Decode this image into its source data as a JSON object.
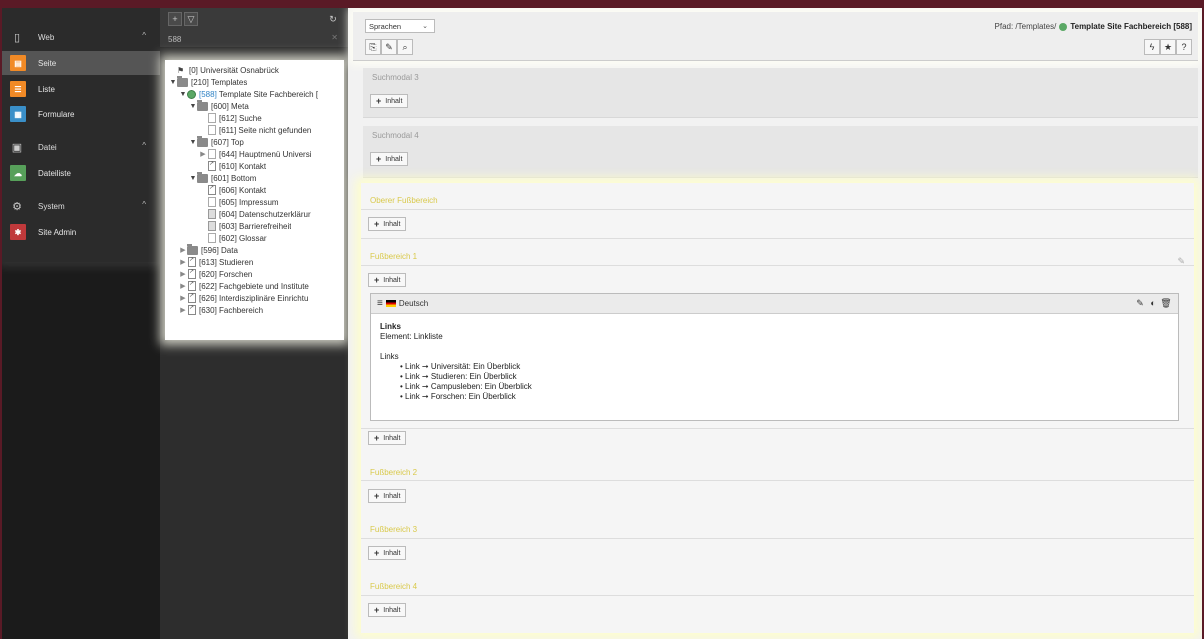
{
  "modmenu": {
    "groups": [
      {
        "label": "Web",
        "icon": "page-icon"
      },
      {
        "label": "Datei",
        "icon": "image-icon"
      },
      {
        "label": "System",
        "icon": "gear-icon"
      }
    ],
    "items": [
      {
        "label": "Seite",
        "color": "#f18a26"
      },
      {
        "label": "Liste",
        "color": "#f18a26"
      },
      {
        "label": "Formulare",
        "color": "#3a8fc8"
      },
      {
        "label": "Dateiliste",
        "color": "#57a05a"
      },
      {
        "label": "Site Admin",
        "color": "#c0393b"
      }
    ]
  },
  "tree": {
    "filter_value": "588",
    "nodes": [
      {
        "uid": "[0]",
        "label": " Universität Osnabrück"
      },
      {
        "uid": "[210]",
        "label": " Templates"
      },
      {
        "uid": "[588]",
        "label": " Template Site Fachbereich ["
      },
      {
        "uid": "[600]",
        "label": " Meta"
      },
      {
        "uid": "[612]",
        "label": " Suche"
      },
      {
        "uid": "[611]",
        "label": " Seite nicht gefunden"
      },
      {
        "uid": "[607]",
        "label": " Top"
      },
      {
        "uid": "[644]",
        "label": " Hauptmenü Universi"
      },
      {
        "uid": "[610]",
        "label": " Kontakt"
      },
      {
        "uid": "[601]",
        "label": " Bottom"
      },
      {
        "uid": "[606]",
        "label": " Kontakt"
      },
      {
        "uid": "[605]",
        "label": " Impressum"
      },
      {
        "uid": "[604]",
        "label": " Datenschutzerklärur"
      },
      {
        "uid": "[603]",
        "label": " Barrierefreiheit"
      },
      {
        "uid": "[602]",
        "label": " Glossar"
      },
      {
        "uid": "[596]",
        "label": " Data"
      },
      {
        "uid": "[613]",
        "label": " Studieren"
      },
      {
        "uid": "[620]",
        "label": " Forschen"
      },
      {
        "uid": "[622]",
        "label": " Fachgebiete und Institute"
      },
      {
        "uid": "[626]",
        "label": " Interdisziplinäre Einrichtu"
      },
      {
        "uid": "[630]",
        "label": " Fachbereich"
      }
    ]
  },
  "header": {
    "language_select": "Sprachen",
    "path_prefix": "Pfad: /Templates/",
    "path_title": "Template Site Fachbereich [588]"
  },
  "content": {
    "add_label": "Inhalt",
    "dim_columns": [
      "Suchmodal 3",
      "Suchmodal 4"
    ],
    "zones": [
      "Oberer Fußbereich",
      "Fußbereich 1",
      "Fußbereich 2",
      "Fußbereich 3",
      "Fußbereich 4"
    ],
    "element": {
      "language": "Deutsch",
      "title": "Links",
      "type_line": "Element: Linkliste",
      "links_heading": "Links",
      "links": [
        "• Link ➞ Universität: Ein Überblick",
        "• Link ➞ Studieren: Ein Überblick",
        "• Link ➞ Campusleben: Ein Überblick",
        "• Link ➞ Forschen: Ein Überblick"
      ]
    }
  }
}
